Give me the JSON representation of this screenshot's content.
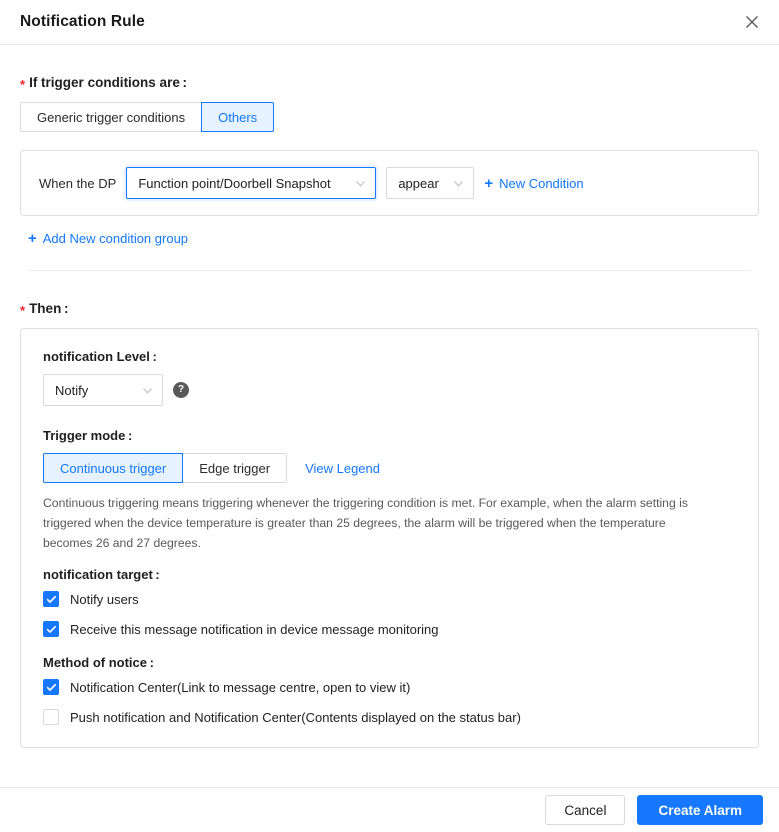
{
  "header": {
    "title": "Notification Rule",
    "close_icon": "close-icon"
  },
  "trigger_section": {
    "label": "If trigger conditions are :",
    "required_marker": "*",
    "tabs": [
      {
        "label": "Generic trigger conditions",
        "active": false
      },
      {
        "label": "Others",
        "active": true
      }
    ],
    "condition_group": {
      "prefix_label": "When the DP",
      "dp_select": {
        "value": "Function point/Doorbell Snapshot",
        "focused": true,
        "caret_icon": "chevron-down-icon"
      },
      "operator_select": {
        "value": "appear",
        "focused": false,
        "caret_icon": "chevron-down-icon"
      },
      "new_condition_label": "New Condition",
      "new_condition_icon": "plus-icon"
    },
    "add_group_label": "Add New condition group",
    "add_group_icon": "plus-icon"
  },
  "then_section": {
    "label": "Then :",
    "required_marker": "*",
    "notification_level": {
      "label": "notification Level :",
      "value": "Notify",
      "caret_icon": "chevron-down-icon",
      "help_icon": "question-mark-icon",
      "help_glyph": "?"
    },
    "trigger_mode": {
      "label": "Trigger mode :",
      "options": [
        {
          "label": "Continuous trigger",
          "active": true
        },
        {
          "label": "Edge trigger",
          "active": false
        }
      ],
      "view_legend_label": "View Legend",
      "description": "Continuous triggering means triggering whenever the triggering condition is met. For example, when the alarm setting is triggered when the device temperature is greater than 25 degrees, the alarm will be triggered when the temperature becomes 26 and 27 degrees."
    },
    "notification_target": {
      "label": "notification target :",
      "items": [
        {
          "label": "Notify users",
          "checked": true
        },
        {
          "label": "Receive this message notification in device message monitoring",
          "checked": true
        }
      ]
    },
    "method_of_notice": {
      "label": "Method of notice :",
      "items": [
        {
          "label": "Notification Center(Link to message centre, open to view it)",
          "checked": true
        },
        {
          "label": "Push notification and Notification Center(Contents displayed on the status bar)",
          "checked": false
        }
      ]
    }
  },
  "footer": {
    "cancel_label": "Cancel",
    "submit_label": "Create Alarm"
  },
  "colors": {
    "accent": "#1677ff",
    "accent_soft": "#e6f2ff",
    "required": "#f5222d",
    "border": "#d9d9d9",
    "card_border": "#e0e0e0",
    "muted_text": "#595959"
  }
}
